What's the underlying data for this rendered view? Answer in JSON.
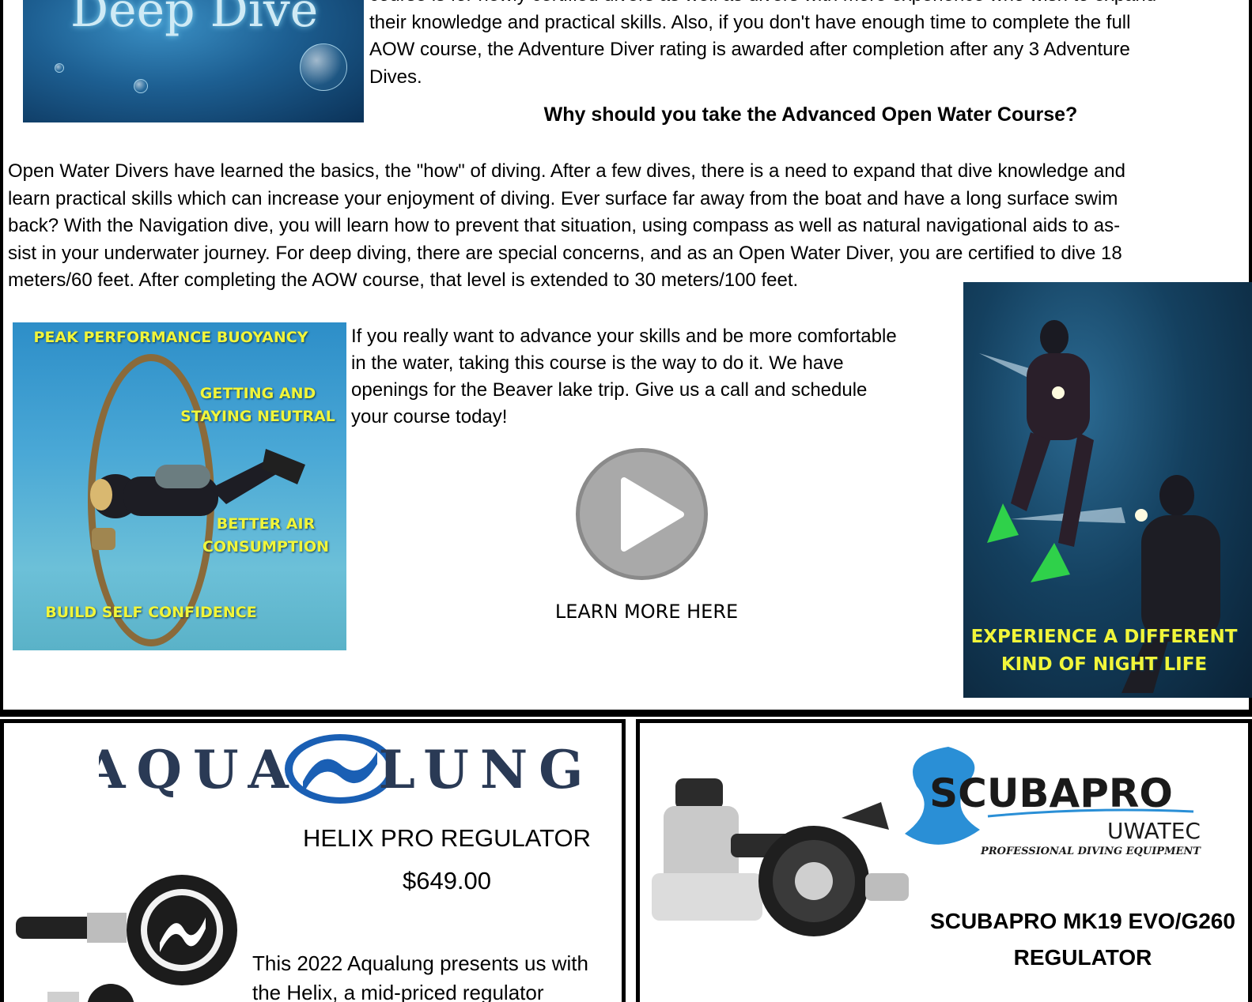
{
  "top": {
    "deep_dive_title": "Deep Dive",
    "intro_lines": [
      "course is for newly certified divers as well as divers with more experience who wish to expand",
      "their knowledge and practical skills. Also, if you don't have enough time to complete the full",
      "AOW course, the Adventure Diver rating is awarded after completion after any 3 Adventure",
      "Dives."
    ],
    "why_heading": "Why should you take the Advanced Open Water Course?",
    "body_lines": [
      "Open Water Divers have learned the basics, the \"how\" of diving. After a few dives, there is a need to expand that dive knowledge and",
      "learn practical skills which can increase your enjoyment of diving. Ever surface far away from the boat and have a long surface swim",
      "back? With the Navigation dive, you will learn how to prevent that situation, using compass as well as natural navigational aids to as-",
      "sist in your underwater journey. For deep diving, there are special concerns, and as an Open Water Diver, you are certified to dive 18",
      "meters/60 feet. After completing the AOW course, that level is extended to 30 meters/100 feet."
    ]
  },
  "buoyancy_image": {
    "caption1": "PEAK PERFORMANCE BUOYANCY",
    "caption2a": "GETTING AND",
    "caption2b": "STAYING NEUTRAL",
    "caption3a": "BETTER AIR",
    "caption3b": "CONSUMPTION",
    "caption4": "BUILD SELF CONFIDENCE"
  },
  "cta": {
    "lines": [
      "If you really want to advance your skills and be more comfortable",
      "in the water, taking this course is the way to do it.  We have",
      "openings for the  Beaver lake trip.  Give us a call and schedule",
      "your course   today!"
    ],
    "learn_more": "LEARN MORE HERE"
  },
  "night_image": {
    "caption_a": "EXPERIENCE A DIFFERENT",
    "caption_b": "KIND OF NIGHT LIFE"
  },
  "aqualung_ad": {
    "brand_left": "AQUA",
    "brand_right": "LUNG",
    "title": "HELIX PRO REGULATOR",
    "price": "$649.00",
    "text_lines": [
      "This 2022 Aqualung presents us with",
      "the Helix, a mid-priced regulator"
    ]
  },
  "scubapro_ad": {
    "brand": "SCUBAPRO",
    "sub_brand": "UWATEC",
    "tagline": "PROFESSIONAL DIVING EQUIPMENT",
    "title_a": "SCUBAPRO MK19 EVO/G260",
    "title_b": "REGULATOR"
  },
  "colors": {
    "caption_yellow": "#f1f53a",
    "aqualung_blue": "#1a5fb4",
    "scubapro_blue": "#2a8fd6"
  }
}
